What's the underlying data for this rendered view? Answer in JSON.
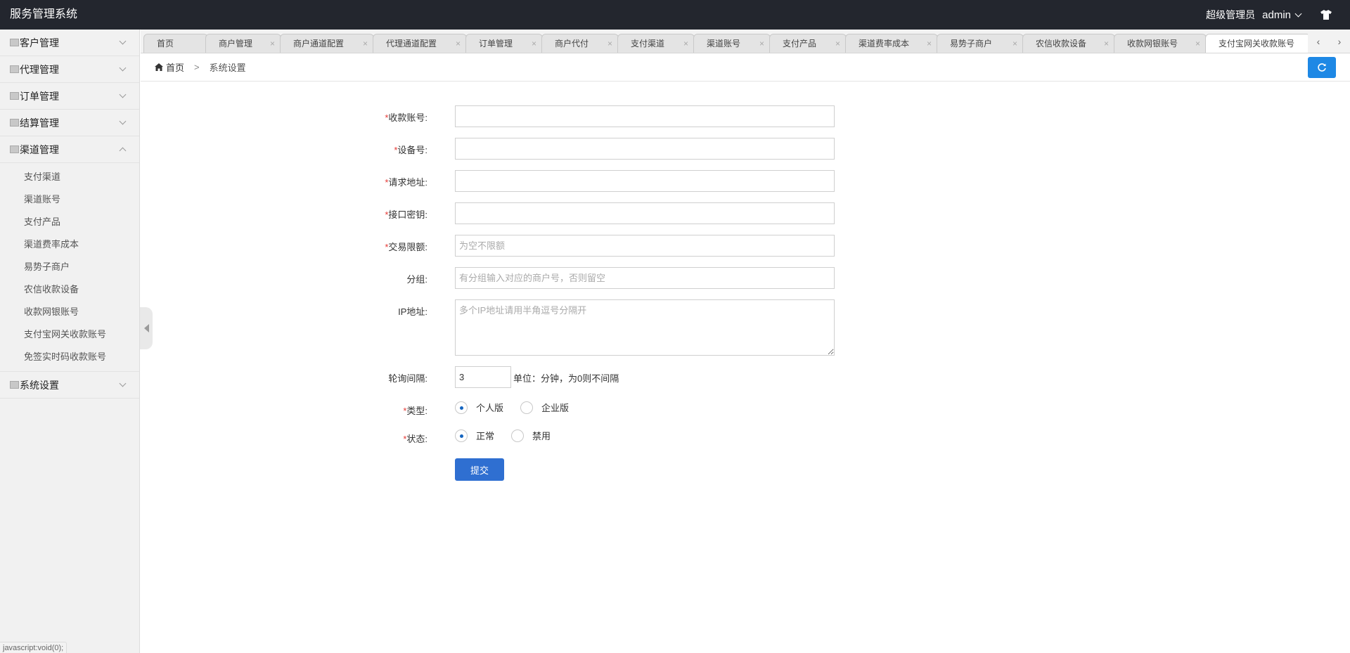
{
  "app": {
    "title": "服务管理系统"
  },
  "header": {
    "role": "超级管理员",
    "username": "admin",
    "skin_icon": "tshirt-icon"
  },
  "sidebar": {
    "groups": [
      {
        "label": "客户管理",
        "expanded": false
      },
      {
        "label": "代理管理",
        "expanded": false
      },
      {
        "label": "订单管理",
        "expanded": false
      },
      {
        "label": "结算管理",
        "expanded": false
      },
      {
        "label": "渠道管理",
        "expanded": true,
        "items": [
          "支付渠道",
          "渠道账号",
          "支付产品",
          "渠道费率成本",
          "易势子商户",
          "农信收款设备",
          "收款网银账号",
          "支付宝网关收款账号",
          "免签实时码收款账号"
        ]
      },
      {
        "label": "系统设置",
        "expanded": false
      }
    ],
    "status_url": "javascript:void(0);"
  },
  "tabs": [
    {
      "label": "首页"
    },
    {
      "label": "商户管理"
    },
    {
      "label": "商户通道配置"
    },
    {
      "label": "代理通道配置"
    },
    {
      "label": "订单管理"
    },
    {
      "label": "商户代付"
    },
    {
      "label": "支付渠道"
    },
    {
      "label": "渠道账号"
    },
    {
      "label": "支付产品"
    },
    {
      "label": "渠道费率成本"
    },
    {
      "label": "易势子商户"
    },
    {
      "label": "农信收款设备"
    },
    {
      "label": "收款网银账号"
    },
    {
      "label": "支付宝网关收款账号"
    }
  ],
  "tab_close": "×",
  "tab_scroll": {
    "left": "‹",
    "right": "›"
  },
  "breadcrumb": {
    "home": "首页",
    "separator": ">",
    "current": "系统设置"
  },
  "form": {
    "account_label": "收款账号:",
    "device_label": "设备号:",
    "url_label": "请求地址:",
    "secret_label": "接口密钥:",
    "limit_label": "交易限额:",
    "limit_placeholder": "为空不限额",
    "group_label": "分组:",
    "group_placeholder": "有分组输入对应的商户号，否则留空",
    "ip_label": "IP地址:",
    "ip_placeholder": "多个IP地址请用半角逗号分隔开",
    "interval_label": "轮询间隔:",
    "interval_value": "3",
    "interval_hint": "单位：分钟，为0则不间隔",
    "type_label": "类型:",
    "type_options": [
      "个人版",
      "企业版"
    ],
    "type_selected": "个人版",
    "status_label": "状态:",
    "status_options": [
      "正常",
      "禁用"
    ],
    "status_selected": "正常",
    "submit_label": "提交",
    "required_mark": "*"
  },
  "colors": {
    "topbar": "#23262e",
    "primary": "#2f6fd1",
    "refresh": "#1e88e5",
    "required": "#e53935"
  }
}
